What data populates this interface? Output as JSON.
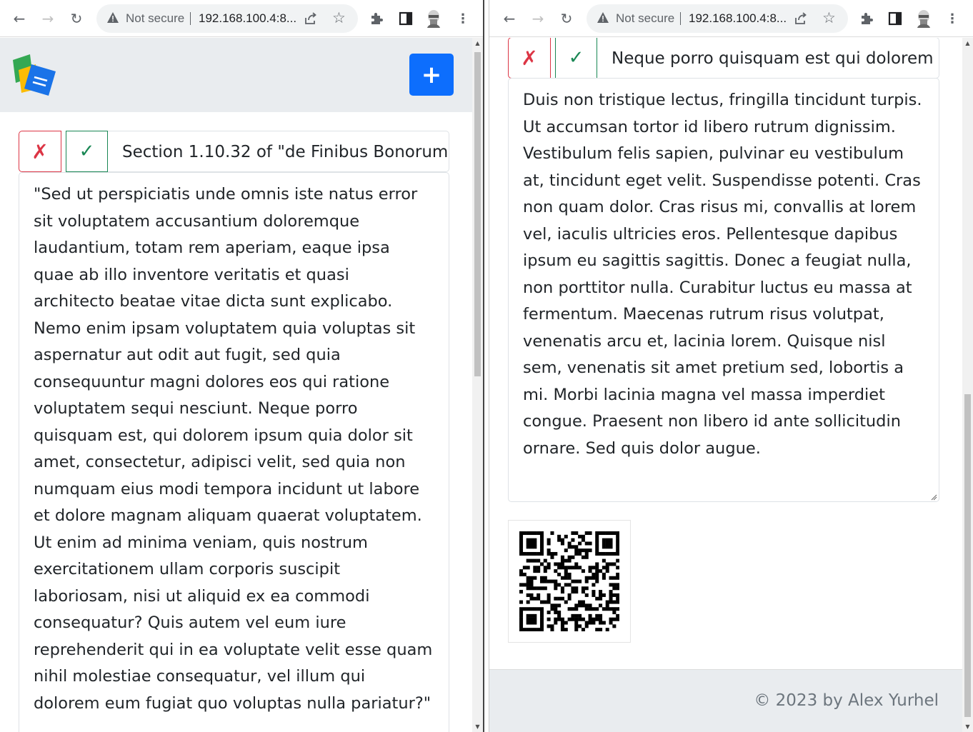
{
  "left_window": {
    "browser": {
      "security_label": "Not secure",
      "url": "192.168.100.4:8...",
      "icons": [
        "back-icon",
        "forward-icon",
        "reload-icon",
        "warning-icon",
        "share-icon",
        "star-icon",
        "extensions-icon",
        "side-panel-icon",
        "profile-avatar",
        "menu-icon"
      ]
    },
    "header": {
      "add_label": "+"
    },
    "note": {
      "delete_symbol": "✗",
      "save_symbol": "✓",
      "title": "Section 1.10.32 of \"de Finibus Bonorum",
      "body": "\"Sed ut perspiciatis unde omnis iste natus error sit voluptatem accusantium doloremque laudantium, totam rem aperiam, eaque ipsa quae ab illo inventore veritatis et quasi architecto beatae vitae dicta sunt explicabo. Nemo enim ipsam voluptatem quia voluptas sit aspernatur aut odit aut fugit, sed quia consequuntur magni dolores eos qui ratione voluptatem sequi nesciunt. Neque porro quisquam est, qui dolorem ipsum quia dolor sit amet, consectetur, adipisci velit, sed quia non numquam eius modi tempora incidunt ut labore et dolore magnam aliquam quaerat voluptatem. Ut enim ad minima veniam, quis nostrum exercitationem ullam corporis suscipit laboriosam, nisi ut aliquid ex ea commodi consequatur? Quis autem vel eum iure reprehenderit qui in ea voluptate velit esse quam nihil molestiae consequatur, vel illum qui dolorem eum fugiat quo voluptas nulla pariatur?\""
    }
  },
  "right_window": {
    "browser": {
      "security_label": "Not secure",
      "url": "192.168.100.4:8..."
    },
    "note": {
      "delete_symbol": "✗",
      "save_symbol": "✓",
      "title": "Neque porro quisquam est qui dolorem",
      "body": "Duis non tristique lectus, fringilla tincidunt turpis. Ut accumsan tortor id libero rutrum dignissim. Vestibulum felis sapien, pulvinar eu vestibulum at, tincidunt eget velit. Suspendisse potenti. Cras non quam dolor. Cras risus mi, convallis at lorem vel, iaculis ultricies eros. Pellentesque dapibus ipsum eu sagittis sagittis. Donec a feugiat nulla, non porttitor nulla. Curabitur luctus eu massa at fermentum. Maecenas rutrum risus volutpat, venenatis arcu et, lacinia lorem. Quisque nisl sem, venenatis sit amet pretium sed, lobortis a mi. Morbi lacinia magna vel massa imperdiet congue. Praesent non libero id ante sollicitudin ornare. Sed quis dolor augue."
    },
    "footer": {
      "text": "© 2023 by Alex Yurhel"
    }
  },
  "colors": {
    "primary": "#0d6efd",
    "danger": "#dc3545",
    "success": "#198754",
    "header_bg": "#e9ecef",
    "footer_text": "#6c757d"
  }
}
